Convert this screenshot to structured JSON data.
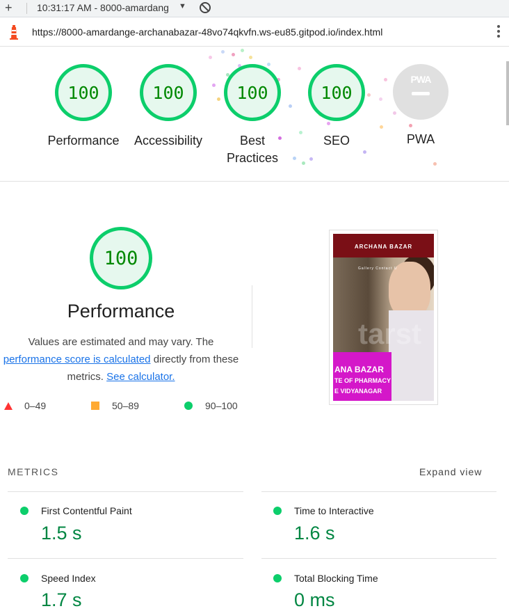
{
  "tab": {
    "plus": "+",
    "title": "10:31:17 AM - 8000-amardang",
    "caret": "▼"
  },
  "address_bar": {
    "url": "https://8000-amardange-archanabazar-48vo74qkvfn.ws-eu85.gitpod.io/index.html"
  },
  "scores": {
    "performance": {
      "score": "100",
      "label": "Performance"
    },
    "accessibility": {
      "score": "100",
      "label": "Accessibility"
    },
    "best_practices": {
      "score": "100",
      "label_line1": "Best",
      "label_line2": "Practices"
    },
    "seo": {
      "score": "100",
      "label": "SEO"
    },
    "pwa": {
      "badge": "PWA",
      "label": "PWA"
    }
  },
  "performance_section": {
    "score": "100",
    "title": "Performance",
    "desc_part1": "Values are estimated and may vary. The",
    "desc_link1": "performance score is calculated",
    "desc_part2": "directly from these",
    "desc_part3": "metrics.",
    "desc_link2": "See calculator.",
    "legend": {
      "fail": "0–49",
      "average": "50–89",
      "pass": "90–100"
    }
  },
  "thumbnail": {
    "site_title": "ARCHANA BAZAR",
    "nav": "Gallery  Contact U",
    "watermark": "tarst",
    "line1": "ANA BAZAR",
    "line2": "TE OF PHARMACY",
    "line3": "E VIDYANAGAR"
  },
  "metrics": {
    "heading": "METRICS",
    "expand": "Expand view",
    "items": [
      {
        "label": "First Contentful Paint",
        "value": "1.5 s"
      },
      {
        "label": "Time to Interactive",
        "value": "1.6 s"
      },
      {
        "label": "Speed Index",
        "value": "1.7 s"
      },
      {
        "label": "Total Blocking Time",
        "value": "0 ms"
      }
    ]
  },
  "colors": {
    "pass": "#0cce6b",
    "pass_text": "#008800",
    "average": "#ffaa33",
    "fail": "#ff3333",
    "link": "#1a73e8"
  }
}
